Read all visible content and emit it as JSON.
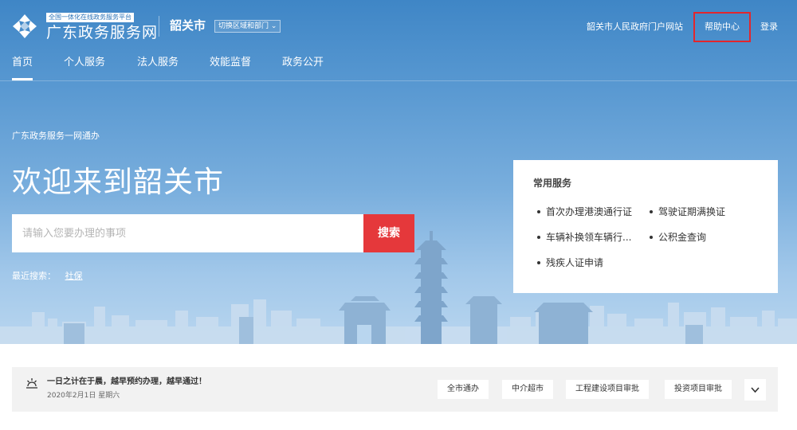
{
  "header": {
    "logo_small": "全国一体化在线政务服务平台",
    "logo_big": "广东政务服务网",
    "city": "韶关市",
    "region_switch": "切换区域和部门 ⌄",
    "portal_link": "韶关市人民政府门户网站",
    "help_link": "帮助中心",
    "login_link": "登录"
  },
  "nav": {
    "items": [
      "首页",
      "个人服务",
      "法人服务",
      "效能监督",
      "政务公开"
    ],
    "active_index": 0
  },
  "hero": {
    "tagline": "广东政务服务一网通办",
    "welcome": "欢迎来到韶关市",
    "search_placeholder": "请输入您要办理的事项",
    "search_button": "搜索",
    "recent_label": "最近搜索：",
    "recent_items": [
      "社保"
    ]
  },
  "services": {
    "title": "常用服务",
    "items": [
      "首次办理港澳通行证",
      "驾驶证期满换证",
      "车辆补换领车辆行...",
      "公积金查询",
      "残疾人证申请"
    ]
  },
  "notice": {
    "title": "一日之计在于晨，越早预约办理，越早通过！",
    "date": "2020年2月1日 星期六",
    "quick_links": [
      "全市通办",
      "中介超市",
      "工程建设项目审批",
      "投资项目审批"
    ]
  },
  "colors": {
    "header_blue": "#3f86c6",
    "search_red": "#e5383b",
    "highlight_border": "#e3262c"
  }
}
